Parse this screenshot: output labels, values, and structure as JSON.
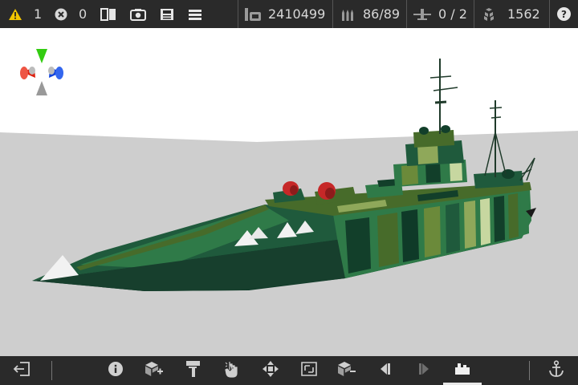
{
  "top_bar": {
    "warnings": {
      "icon": "warning-icon",
      "count": "1"
    },
    "errors": {
      "icon": "error-icon",
      "count": "0"
    },
    "tools": [
      {
        "name": "compare-view-icon"
      },
      {
        "name": "screenshot-camera-icon"
      },
      {
        "name": "save-floppy-icon"
      },
      {
        "name": "menu-hamburger-icon"
      }
    ],
    "weight": {
      "icon": "weight-icon",
      "value": "2410499"
    },
    "ammo": {
      "icon": "ammo-icon",
      "value": "86/89"
    },
    "aircraft": {
      "icon": "aircraft-icon",
      "value": "0 / 2"
    },
    "parts": {
      "icon": "parts-icon",
      "value": "1562"
    },
    "help": {
      "icon": "help-icon",
      "label": "?"
    }
  },
  "viewport": {
    "sky_color": "#ffffff",
    "ground_color": "#cecece",
    "axis_gizmo": {
      "up_color": "#33cc11",
      "left_color": "#dd2211",
      "right_color": "#1144dd",
      "down_color": "#999999"
    },
    "ship": {
      "hull_colors": [
        "#1f5a3c",
        "#2f7a48",
        "#476b2a",
        "#6b8a3a",
        "#123f2a",
        "#8fa85a",
        "#c7d7a0"
      ],
      "turret_color": "#c62828"
    }
  },
  "bottom_bar": {
    "buttons": [
      {
        "name": "exit-icon"
      },
      {
        "name": "info-icon"
      },
      {
        "name": "add-block-icon"
      },
      {
        "name": "paint-roller-icon"
      },
      {
        "name": "hand-select-icon"
      },
      {
        "name": "move-arrows-icon"
      },
      {
        "name": "resize-frame-icon"
      },
      {
        "name": "remove-block-icon"
      },
      {
        "name": "previous-icon"
      },
      {
        "name": "next-icon"
      },
      {
        "name": "fleet-icon"
      },
      {
        "name": "anchor-icon"
      }
    ],
    "active": "fleet-icon"
  }
}
